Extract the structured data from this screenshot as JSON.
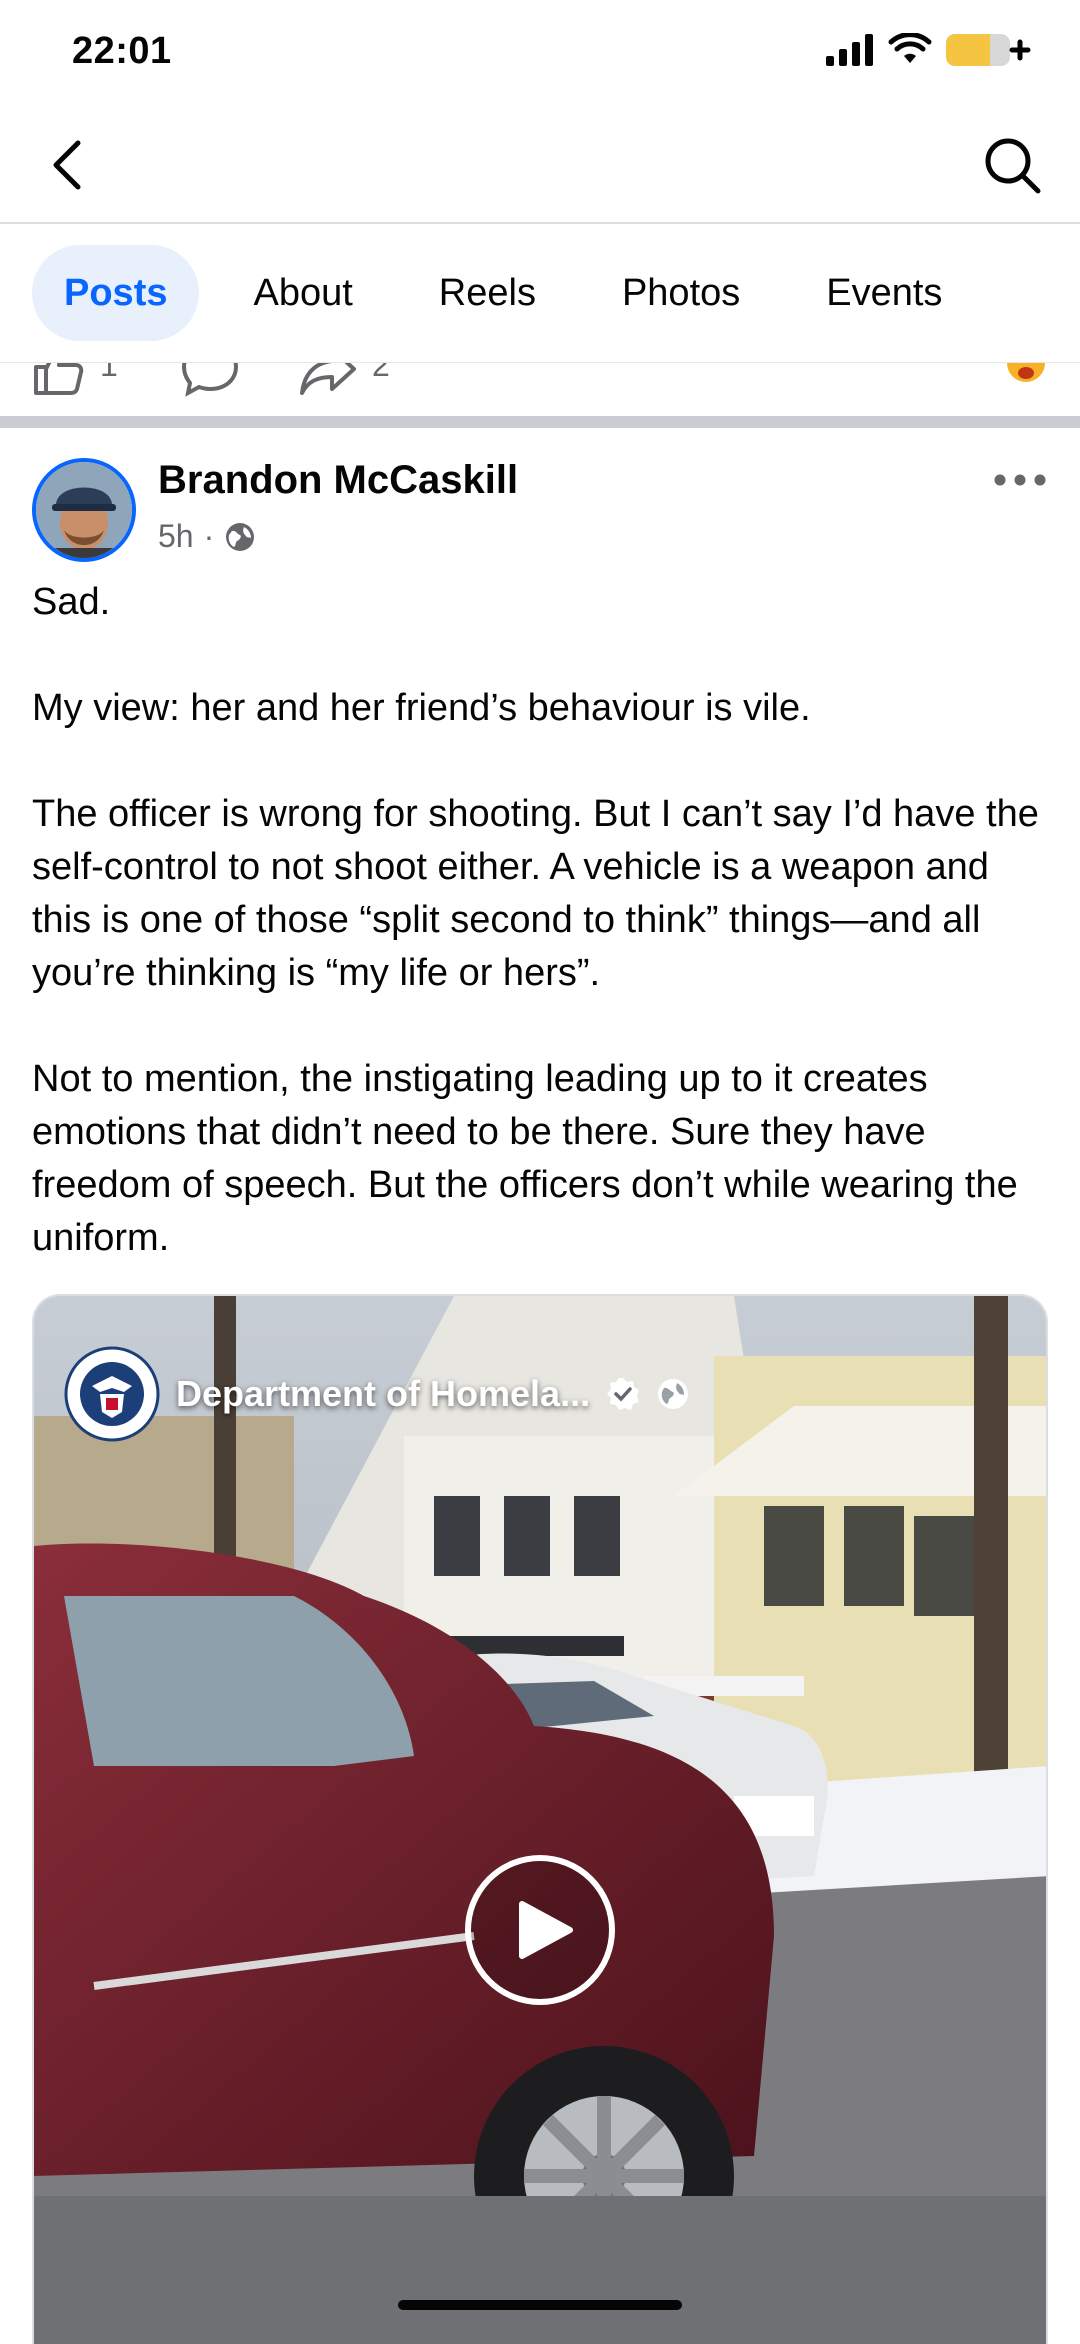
{
  "status_bar": {
    "time": "22:01"
  },
  "tabs": [
    {
      "label": "Posts",
      "active": true
    },
    {
      "label": "About",
      "active": false
    },
    {
      "label": "Reels",
      "active": false
    },
    {
      "label": "Photos",
      "active": false
    },
    {
      "label": "Events",
      "active": false
    }
  ],
  "previous_post": {
    "like_count": "1",
    "share_count": "2"
  },
  "post": {
    "author": "Brandon McCaskill",
    "time": "5h",
    "privacy_icon": "globe-icon",
    "paragraphs": [
      "Sad.",
      "My view: her and her friend’s behaviour is vile.",
      "The officer is wrong for shooting. But I can’t say I’d have the self-control to not shoot either. A vehicle is a weapon and this is one of those “split second to think” things—and all you’re thinking is “my life or hers”.",
      "Not to mention, the instigating leading up to it creates emotions that didn’t need to be there. Sure they have freedom of speech. But the officers don’t while wearing the uniform."
    ],
    "video": {
      "source": "Department of Homela...",
      "verified": true
    }
  },
  "colors": {
    "accent": "#0866ff",
    "active_tab_bg": "#e7f0fb",
    "secondary_text": "#65676b",
    "separator": "#c9ccd1"
  }
}
